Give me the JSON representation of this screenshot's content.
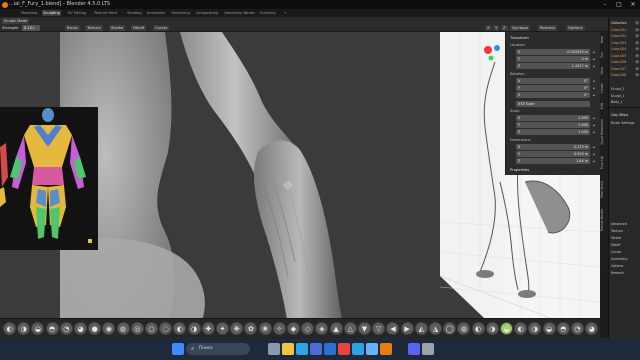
{
  "window": {
    "title": "...ial_F_Fury_1.blend] - Blender 4.5.0 LTS",
    "minimize_icon": "minimize-icon",
    "maximize_icon": "maximize-icon",
    "close_icon": "close-icon"
  },
  "workspace_tabs": [
    {
      "label": "Modeling",
      "active": false
    },
    {
      "label": "Sculpting",
      "active": true
    },
    {
      "label": "UV Editing",
      "active": false
    },
    {
      "label": "Texture Paint",
      "active": false
    },
    {
      "label": "Shading",
      "active": false
    },
    {
      "label": "Animation",
      "active": false
    },
    {
      "label": "Rendering",
      "active": false
    },
    {
      "label": "Compositing",
      "active": false
    },
    {
      "label": "Geometry Nodes",
      "active": false
    },
    {
      "label": "Scripting",
      "active": false
    },
    {
      "label": "+",
      "active": false
    }
  ],
  "header": {
    "mode": "Sculpt Mode",
    "strength_label": "Strength",
    "strength_value": "0.151",
    "brush_menu": "Brush",
    "texture_menu": "Texture",
    "stroke_menu": "Stroke",
    "falloff_menu": "Falloff",
    "cursor_menu": "Cursor",
    "xyz": [
      "X",
      "Y",
      "Z"
    ],
    "right_menus": [
      "Dyntopo",
      "Remesh",
      "Options"
    ]
  },
  "npanel": {
    "transform_title": "Transform",
    "location_label": "Location",
    "location": [
      {
        "axis": "X",
        "value": "-0.002429 m"
      },
      {
        "axis": "Y",
        "value": "0 m"
      },
      {
        "axis": "Z",
        "value": "1.1527 m"
      }
    ],
    "rotation_label": "Rotation",
    "rotation": [
      {
        "axis": "X",
        "value": "0°"
      },
      {
        "axis": "Y",
        "value": "0°"
      },
      {
        "axis": "Z",
        "value": "0°"
      }
    ],
    "rotation_mode": "XYZ Euler",
    "scale_label": "Scale",
    "scale": [
      {
        "axis": "X",
        "value": "1.000"
      },
      {
        "axis": "Y",
        "value": "1.000"
      },
      {
        "axis": "Z",
        "value": "1.000"
      }
    ],
    "dimensions_label": "Dimensions",
    "dimensions": [
      {
        "axis": "X",
        "value": "0.273 m"
      },
      {
        "axis": "Y",
        "value": "0.929 m"
      },
      {
        "axis": "Z",
        "value": "1.44 m"
      }
    ],
    "properties_label": "Properties"
  },
  "vertical_tabs": [
    "Item",
    "Tool",
    "View",
    "Create",
    "Edit",
    "Quad Remesher",
    "Pose Lib",
    "Real Snow",
    "Texture Nodes"
  ],
  "outliner": {
    "items": [
      "Collection",
      "Cube.001",
      "Cube.002",
      "Cube.003",
      "Cube.004",
      "Cube.005",
      "Cube.006",
      "Cube.007",
      "Cube.008"
    ],
    "lower_items": [
      "Sculpt_2",
      "Sculpt_1",
      "Body_1"
    ]
  },
  "properties_panel": {
    "brush_label": "Clay Strips",
    "sections": [
      "Brush Settings",
      "Advanced",
      "Texture",
      "Stroke",
      "Falloff",
      "Cursor",
      "Symmetry",
      "Options",
      "Remesh"
    ]
  },
  "brushes": [
    "draw",
    "draw-sharp",
    "clay",
    "clay-strips",
    "clay-thumb",
    "layer",
    "inflate",
    "blob",
    "crease",
    "smooth",
    "flatten",
    "fill",
    "scrape",
    "multiplane-scrape",
    "pinch",
    "grab",
    "elastic-deform",
    "snake-hook",
    "thumb",
    "pose",
    "nudge",
    "rotate",
    "slide-relax",
    "boundary",
    "cloth",
    "simplify",
    "mask",
    "draw-face-sets",
    "multires-displacement",
    "paint",
    "smear",
    "box-mask",
    "box-hide",
    "box-face-set",
    "box-trim",
    "line-project",
    "mesh-filter",
    "cloth-filter",
    "color-filter",
    "edit-face-set",
    "mask-by-color",
    "transform"
  ],
  "taskbar": {
    "search_placeholder": "Поиск",
    "icons": [
      "windows-start-icon",
      "search-icon",
      "task-view-icon",
      "file-explorer-icon",
      "edge-browser-icon",
      "store-icon",
      "mail-icon",
      "chrome-icon",
      "telegram-icon",
      "photos-icon",
      "blender-icon",
      "steam-icon",
      "discord-icon",
      "settings-icon"
    ]
  },
  "colors": {
    "viewport_bg": "#3a3a3a",
    "header_bg": "#2b2b2b",
    "accent_active_tab": "#3a3a3a",
    "blender_orange": "#e87d0d",
    "taskbar_bg": "#1e2a3a"
  }
}
